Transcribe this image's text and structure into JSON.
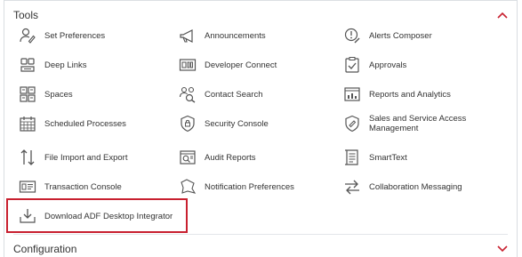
{
  "tools": {
    "title": "Tools",
    "items": [
      {
        "label": "Set Preferences",
        "icon": "user-settings-icon"
      },
      {
        "label": "Announcements",
        "icon": "megaphone-icon"
      },
      {
        "label": "Alerts Composer",
        "icon": "alert-composer-icon"
      },
      {
        "label": "Deep Links",
        "icon": "deep-links-icon"
      },
      {
        "label": "Developer Connect",
        "icon": "developer-connect-icon"
      },
      {
        "label": "Approvals",
        "icon": "approvals-icon"
      },
      {
        "label": "Spaces",
        "icon": "spaces-icon"
      },
      {
        "label": "Contact Search",
        "icon": "contact-search-icon"
      },
      {
        "label": "Reports and Analytics",
        "icon": "reports-analytics-icon"
      },
      {
        "label": "Scheduled Processes",
        "icon": "calendar-icon"
      },
      {
        "label": "Security Console",
        "icon": "security-shield-icon"
      },
      {
        "label": "Sales and Service Access Management",
        "icon": "access-management-icon"
      },
      {
        "label": "File Import and Export",
        "icon": "import-export-icon"
      },
      {
        "label": "Audit Reports",
        "icon": "audit-reports-icon"
      },
      {
        "label": "SmartText",
        "icon": "smarttext-icon"
      },
      {
        "label": "Transaction Console",
        "icon": "transaction-console-icon"
      },
      {
        "label": "Notification Preferences",
        "icon": "notification-icon"
      },
      {
        "label": "Collaboration Messaging",
        "icon": "collaboration-messaging-icon"
      },
      {
        "label": "Download ADF Desktop Integrator",
        "icon": "download-icon"
      }
    ]
  },
  "configuration": {
    "title": "Configuration"
  },
  "colors": {
    "chevron": "#c8202f",
    "highlight_border": "#c8202f",
    "icon_stroke": "#555555",
    "text": "#333333"
  }
}
